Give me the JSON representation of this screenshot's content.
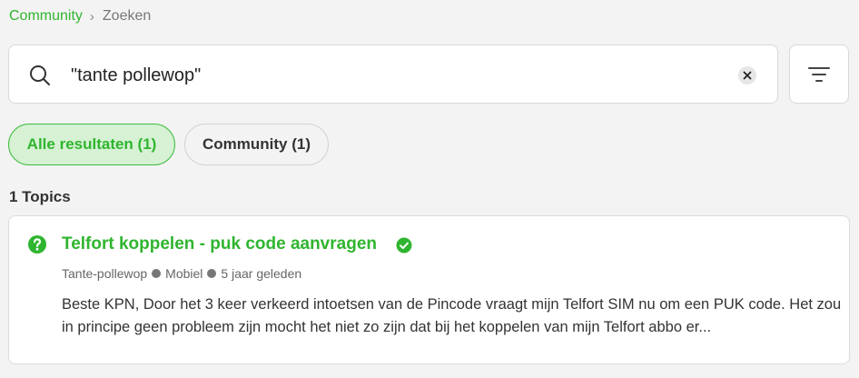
{
  "breadcrumb": {
    "home": "Community",
    "separator": "›",
    "current": "Zoeken"
  },
  "search": {
    "value": "\"tante pollewop\"",
    "placeholder": ""
  },
  "filters": {
    "tabs": [
      {
        "label": "Alle resultaten (1)",
        "active": true
      },
      {
        "label": "Community (1)",
        "active": false
      }
    ]
  },
  "results": {
    "count_label": "1 Topics",
    "items": [
      {
        "title": "Telfort koppelen - puk code aanvragen",
        "status_icon": "question-icon",
        "solved_icon": "check-circle-icon",
        "author": "Tante-pollewop",
        "category": "Mobiel",
        "time": "5 jaar geleden",
        "excerpt": "Beste KPN, Door het 3 keer verkeerd intoetsen van de Pincode vraagt mijn Telfort SIM nu om een PUK code. Het zou in principe geen probleem zijn mocht het niet zo zijn dat bij het koppelen van mijn Telfort abbo er..."
      }
    ]
  },
  "colors": {
    "accent": "#2fb52f",
    "pill_active_bg": "#d6f1d3",
    "background": "#f3f3f3"
  }
}
